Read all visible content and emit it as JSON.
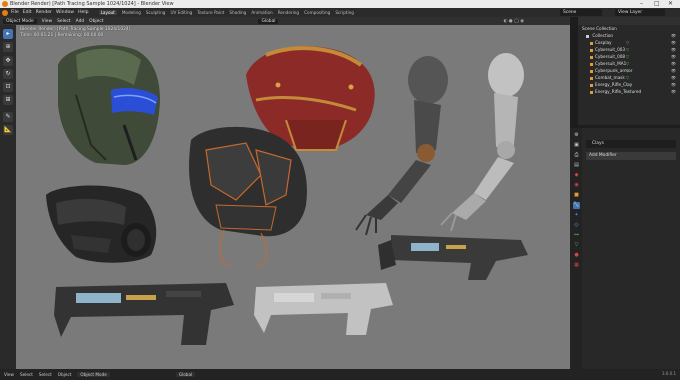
{
  "window": {
    "title": "Blender Render) [Path Tracing Sample 1024/1024] - Blender View",
    "minimize": "–",
    "maximize": "□",
    "close": "✕"
  },
  "menu": {
    "items": [
      "File",
      "Edit",
      "Render",
      "Window",
      "Help"
    ],
    "workspaces": [
      "Layout",
      "Modeling",
      "Sculpting",
      "UV Editing",
      "Texture Paint",
      "Shading",
      "Animation",
      "Rendering",
      "Compositing",
      "Scripting"
    ],
    "active_workspace": "Layout"
  },
  "scene": {
    "label": "Scene",
    "view_layer": "View Layer"
  },
  "header": {
    "mode": "Object Mode",
    "menus": [
      "View",
      "Select",
      "Add",
      "Object"
    ],
    "transform": "Global"
  },
  "viewport": {
    "info_line1": "Blender Render) [Path Tracing Sample 1024/1024]",
    "info_line2": "Time: 00:01.21 | Remaining: 00:00.00",
    "background": "#7a7a7a"
  },
  "toolbar": {
    "tools": [
      "select-icon",
      "cursor-icon",
      "move-icon",
      "rotate-icon",
      "scale-icon",
      "transform-icon",
      "annotate-icon",
      "measure-icon"
    ]
  },
  "outliner": {
    "title": "Scene Collection",
    "collection": "Collection",
    "items": [
      "Cosplay",
      "Cybersuit_003",
      "Cybersuit_008",
      "Cybersuit_MA1",
      "Cyberpunk_armor",
      "Combat_mask",
      "Energy_Rifle_Clay",
      "Energy_Rifle_Textured"
    ]
  },
  "properties": {
    "object_name": "Clays",
    "add_modifier": "Add Modifier"
  },
  "statusbar": {
    "items": [
      "View",
      "Select",
      "Select",
      "Object",
      "Object Mode",
      "Global"
    ],
    "version": "3.6.0.1"
  },
  "colors": {
    "accent": "#4772b3",
    "brand": "#e87d0d",
    "armor_red": "#8b2a26",
    "gold": "#c48a3a",
    "clay": "#b9b9b9",
    "dark_metal": "#2e2e2e",
    "helmet_green": "#4a5a40",
    "visor_blue": "#2a4fd6"
  }
}
